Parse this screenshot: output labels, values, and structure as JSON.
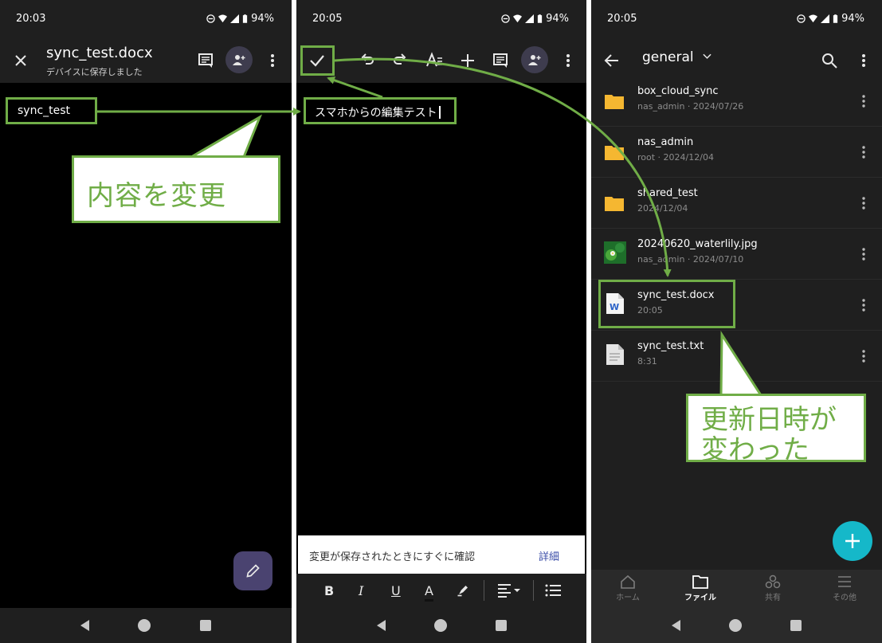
{
  "colors": {
    "annotation_green": "#70ad47",
    "fab_teal": "#15b8c9",
    "fab_purple": "#4a4370"
  },
  "phone1": {
    "status": {
      "time": "20:03",
      "battery": "94%"
    },
    "title": "sync_test.docx",
    "subtitle": "デバイスに保存しました",
    "body_text": "sync_test",
    "icons": [
      "close-icon",
      "comment-icon",
      "share-person-icon",
      "more-vert-icon",
      "edit-pencil-icon"
    ]
  },
  "phone2": {
    "status": {
      "time": "20:05",
      "battery": "94%"
    },
    "body_text": "スマホからの編集テスト",
    "snackbar": {
      "message": "変更が保存されたときにすぐに確認",
      "action": "詳細"
    },
    "format": {
      "bold": "B",
      "italic": "I",
      "underline": "U",
      "color": "A"
    },
    "icons": [
      "check-icon",
      "undo-icon",
      "redo-icon",
      "text-format-icon",
      "add-icon",
      "comment-icon",
      "share-person-icon",
      "more-vert-icon",
      "highlighter-icon",
      "align-icon",
      "list-icon"
    ]
  },
  "phone3": {
    "status": {
      "time": "20:05",
      "battery": "94%"
    },
    "folder": "general",
    "files": [
      {
        "name": "box_cloud_sync",
        "meta": "nas_admin · 2024/07/26",
        "kind": "folder"
      },
      {
        "name": "nas_admin",
        "meta": "root · 2024/12/04",
        "kind": "folder"
      },
      {
        "name": "shared_test",
        "meta": "2024/12/04",
        "kind": "folder"
      },
      {
        "name": "20240620_waterlily.jpg",
        "meta": "nas_admin · 2024/07/10",
        "kind": "image"
      },
      {
        "name": "sync_test.docx",
        "meta": "20:05",
        "kind": "word"
      },
      {
        "name": "sync_test.txt",
        "meta": "8:31",
        "kind": "text"
      }
    ],
    "tabs": [
      {
        "label": "ホーム",
        "active": false
      },
      {
        "label": "ファイル",
        "active": true
      },
      {
        "label": "共有",
        "active": false
      },
      {
        "label": "その他",
        "active": false
      }
    ]
  },
  "annotations": {
    "change_content": "内容を変更",
    "date_changed_line1": "更新日時が",
    "date_changed_line2": "変わった"
  }
}
